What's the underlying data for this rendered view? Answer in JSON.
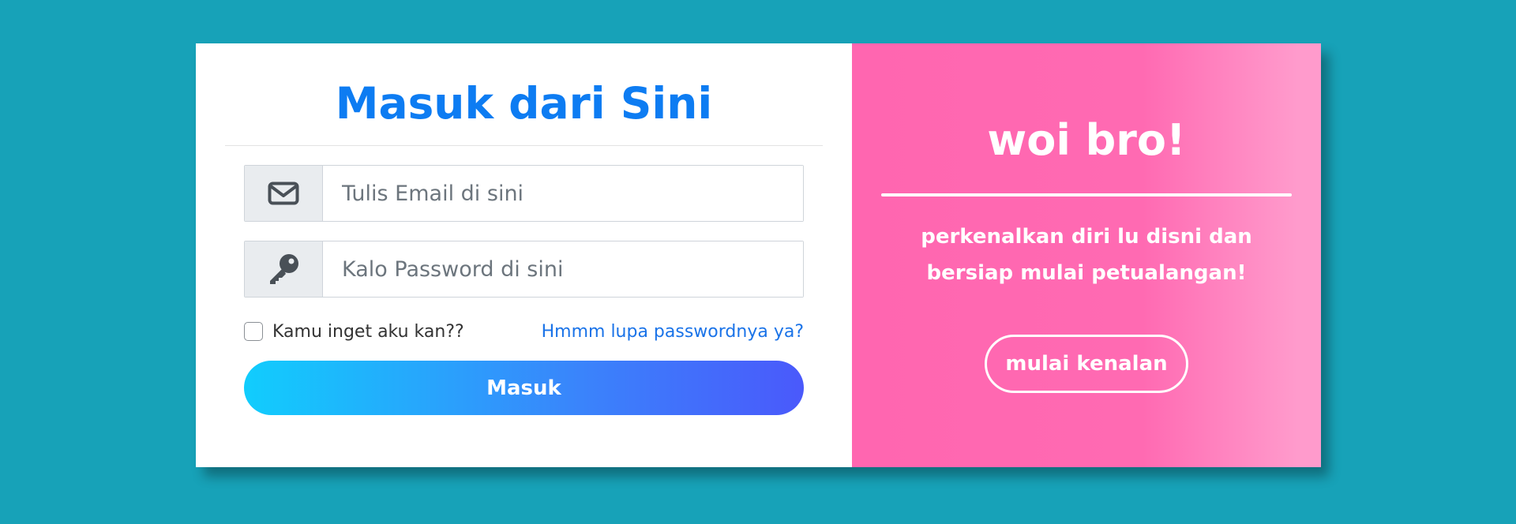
{
  "login": {
    "title": "Masuk dari Sini",
    "email": {
      "placeholder": "Tulis Email di sini",
      "icon": "envelope-icon"
    },
    "password": {
      "placeholder": "Kalo Password di sini",
      "icon": "key-icon"
    },
    "remember_label": "Kamu inget aku kan??",
    "forgot_label": "Hmmm lupa passwordnya ya?",
    "submit_label": "Masuk"
  },
  "register": {
    "title": "woi bro!",
    "text": "perkenalkan diri lu disni dan bersiap mulai petualangan!",
    "button_label": "mulai kenalan"
  },
  "colors": {
    "background": "#17a2b8",
    "title": "#0d7cf2",
    "link": "#1a73e8",
    "panel_pink": "#ff66b0",
    "button_gradient_start": "#11cdfd",
    "button_gradient_end": "#4a59fb"
  }
}
